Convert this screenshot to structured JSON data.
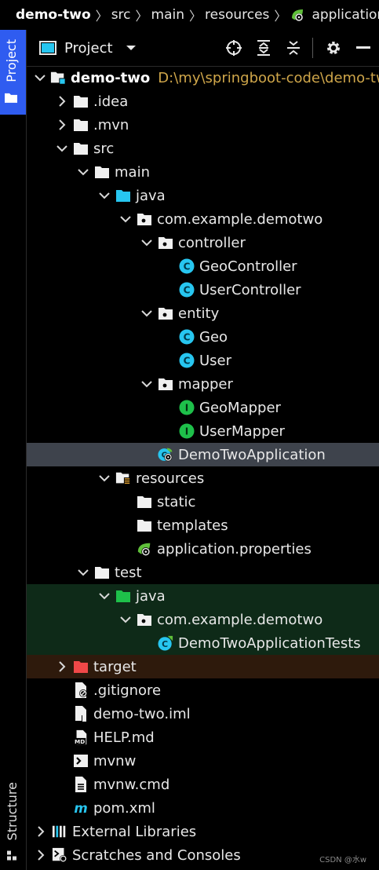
{
  "breadcrumb": {
    "items": [
      "demo-two",
      "src",
      "main",
      "resources",
      "application.properties"
    ]
  },
  "stripe": {
    "project_label": "Project",
    "structure_label": "Structure"
  },
  "toolwindow": {
    "title": "Project",
    "actions": [
      "locate-icon",
      "expand-all-icon",
      "collapse-all-icon",
      "gear-icon",
      "minimize-icon"
    ]
  },
  "tree": [
    {
      "indent": 0,
      "expanded": true,
      "icon": "module-folder-icon",
      "label": "demo-two",
      "bold": true,
      "path": "D:\\my\\springboot-code\\demo-two"
    },
    {
      "indent": 1,
      "expanded": false,
      "icon": "folder-icon",
      "label": ".idea"
    },
    {
      "indent": 1,
      "expanded": false,
      "icon": "folder-icon",
      "label": ".mvn"
    },
    {
      "indent": 1,
      "expanded": true,
      "icon": "folder-icon",
      "label": "src"
    },
    {
      "indent": 2,
      "expanded": true,
      "icon": "folder-icon",
      "label": "main"
    },
    {
      "indent": 3,
      "expanded": true,
      "icon": "source-folder-icon",
      "label": "java"
    },
    {
      "indent": 4,
      "expanded": true,
      "icon": "package-icon",
      "label": "com.example.demotwo"
    },
    {
      "indent": 5,
      "expanded": true,
      "icon": "package-icon",
      "label": "controller"
    },
    {
      "indent": 6,
      "icon": "class-icon",
      "label": "GeoController"
    },
    {
      "indent": 6,
      "icon": "class-icon",
      "label": "UserController"
    },
    {
      "indent": 5,
      "expanded": true,
      "icon": "package-icon",
      "label": "entity"
    },
    {
      "indent": 6,
      "icon": "class-icon",
      "label": "Geo"
    },
    {
      "indent": 6,
      "icon": "class-icon",
      "label": "User"
    },
    {
      "indent": 5,
      "expanded": true,
      "icon": "package-icon",
      "label": "mapper"
    },
    {
      "indent": 6,
      "icon": "interface-icon",
      "label": "GeoMapper"
    },
    {
      "indent": 6,
      "icon": "interface-icon",
      "label": "UserMapper"
    },
    {
      "indent": 5,
      "icon": "spring-boot-app-icon",
      "label": "DemoTwoApplication",
      "selected": true
    },
    {
      "indent": 3,
      "expanded": true,
      "icon": "resources-folder-icon",
      "label": "resources"
    },
    {
      "indent": 4,
      "icon": "folder-icon",
      "label": "static"
    },
    {
      "indent": 4,
      "icon": "folder-icon",
      "label": "templates"
    },
    {
      "indent": 4,
      "icon": "spring-properties-icon",
      "label": "application.properties"
    },
    {
      "indent": 2,
      "expanded": true,
      "icon": "folder-icon",
      "label": "test"
    },
    {
      "indent": 3,
      "expanded": true,
      "icon": "test-source-folder-icon",
      "label": "java",
      "bg": "test"
    },
    {
      "indent": 4,
      "expanded": true,
      "icon": "package-icon",
      "label": "com.example.demotwo",
      "bg": "test"
    },
    {
      "indent": 5,
      "icon": "test-class-icon",
      "label": "DemoTwoApplicationTests",
      "bg": "test"
    },
    {
      "indent": 1,
      "expanded": false,
      "icon": "excluded-folder-icon",
      "label": "target",
      "bg": "excluded"
    },
    {
      "indent": 1,
      "icon": "gitignore-icon",
      "label": ".gitignore"
    },
    {
      "indent": 1,
      "icon": "iml-file-icon",
      "label": "demo-two.iml"
    },
    {
      "indent": 1,
      "icon": "markdown-icon",
      "label": "HELP.md"
    },
    {
      "indent": 1,
      "icon": "shell-script-icon",
      "label": "mvnw"
    },
    {
      "indent": 1,
      "icon": "cmd-file-icon",
      "label": "mvnw.cmd"
    },
    {
      "indent": 1,
      "icon": "maven-icon",
      "label": "pom.xml"
    },
    {
      "indent": 0,
      "expanded": false,
      "icon": "libraries-icon",
      "label": "External Libraries"
    },
    {
      "indent": 0,
      "expanded": false,
      "icon": "scratches-icon",
      "label": "Scratches and Consoles"
    }
  ],
  "watermark": "CSDN @水w",
  "colors": {
    "background": "#000000",
    "selection": "#3e434c",
    "test_background": "#0e2a18",
    "excluded_background": "#2e1a0c",
    "class_icon": "#27c6f0",
    "interface_icon": "#1ec04a",
    "spring_green": "#5fbf3a",
    "module_path": "#cfa64a",
    "stripe_active": "#2f5cf0"
  }
}
